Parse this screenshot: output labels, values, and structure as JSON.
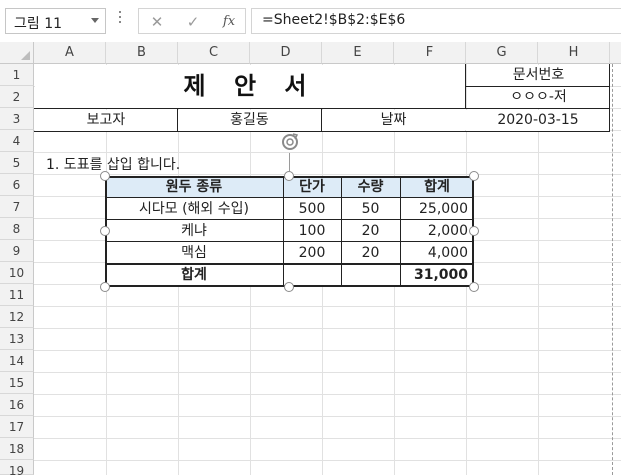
{
  "formula_bar": {
    "name_box": "그림 11",
    "cancel_icon": "✕",
    "enter_icon": "✓",
    "fx_label": "fx",
    "formula": "=Sheet2!$B$2:$E$6"
  },
  "columns": [
    "A",
    "B",
    "C",
    "D",
    "E",
    "F",
    "G",
    "H"
  ],
  "rows": [
    "1",
    "2",
    "3",
    "4",
    "5",
    "6",
    "7",
    "8",
    "9",
    "10",
    "11",
    "12",
    "13",
    "14",
    "15",
    "16",
    "17",
    "18",
    "19"
  ],
  "sheet": {
    "title": "제 안 서",
    "doc_number_label": "문서번호",
    "doc_number_value": "ㅇㅇㅇ-저",
    "reporter_label": "보고자",
    "reporter_name": "홍길동",
    "date_label": "날짜",
    "date_value": "2020-03-15",
    "note": "1. 도표를 삽입 합니다."
  },
  "picture": {
    "headers": [
      "원두 종류",
      "단가",
      "수량",
      "합계"
    ],
    "rows": [
      [
        "시다모 (해외 수입)",
        "500",
        "50",
        "25,000"
      ],
      [
        "케냐",
        "100",
        "20",
        "2,000"
      ],
      [
        "맥심",
        "200",
        "20",
        "4,000"
      ]
    ],
    "total_label": "합계",
    "total_value": "31,000",
    "header_fill": "#ddebf7"
  }
}
